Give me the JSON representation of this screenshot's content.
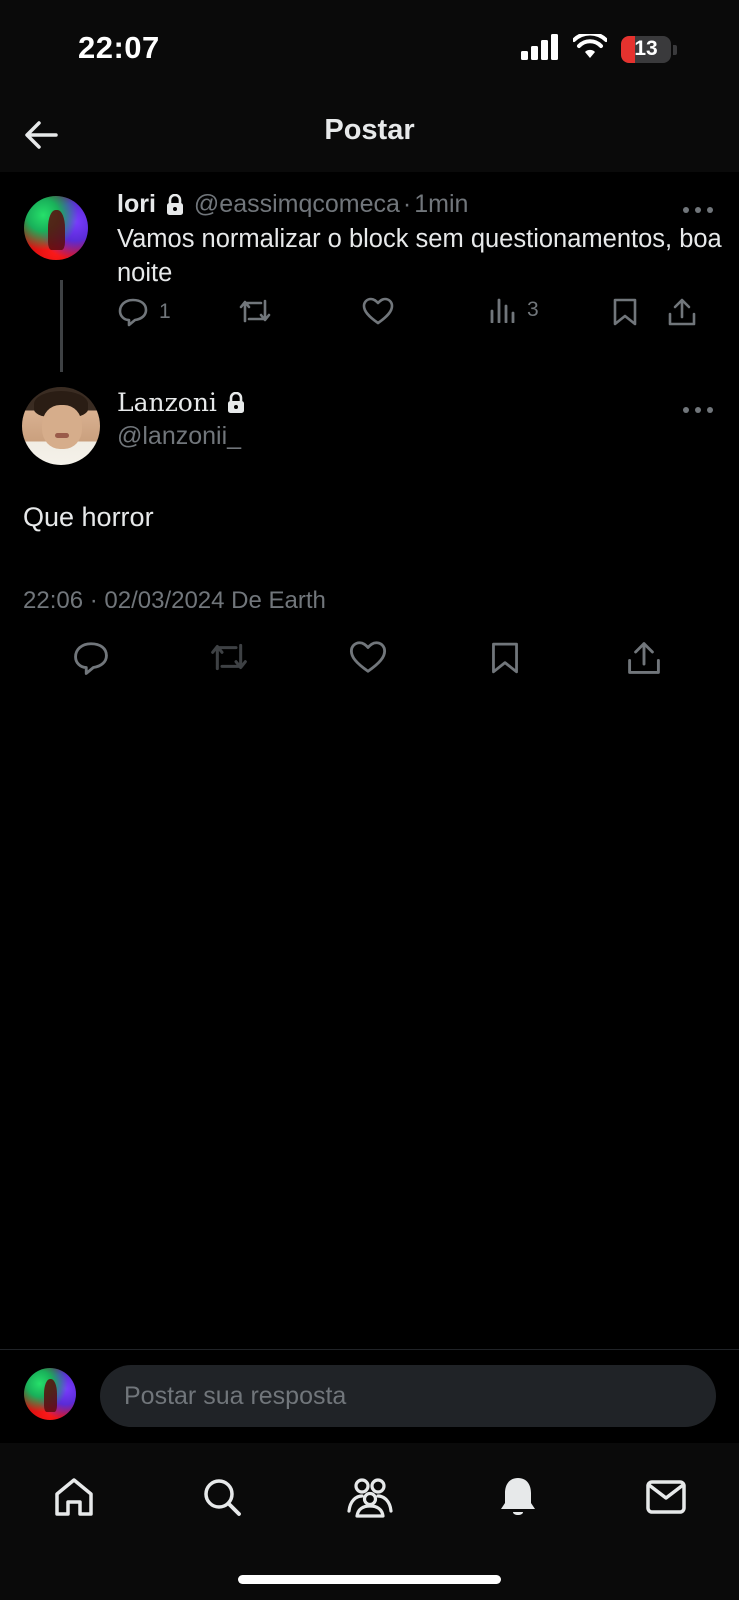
{
  "status_bar": {
    "time": "22:07",
    "battery_level": "13",
    "battery_fraction": 0.13,
    "icons": [
      "signal-icon",
      "wifi-icon",
      "battery-icon"
    ]
  },
  "header": {
    "title": "Postar",
    "back_icon": "arrow-left-icon"
  },
  "parent_post": {
    "display_name": "lori",
    "handle": "@eassimqcomeca",
    "separator": "·",
    "time": "1min",
    "text": "Vamos normalizar o block sem questionamentos, boa noite",
    "reply_count": "1",
    "views_count": "3",
    "locked": true
  },
  "main_post": {
    "display_name": "Lanzoni",
    "handle": "@lanzonii_",
    "text": "Que horror",
    "meta": "22:06 · 02/03/2024 De Earth",
    "locked": true
  },
  "reply_bar": {
    "placeholder": "Postar sua resposta"
  },
  "bottom_nav": {
    "items": [
      "home-icon",
      "search-icon",
      "communities-icon",
      "notifications-icon",
      "messages-icon"
    ]
  },
  "colors": {
    "background": "#000000",
    "text_primary": "#e7e9ea",
    "text_secondary": "#71767b",
    "battery_low": "#e5322e"
  }
}
